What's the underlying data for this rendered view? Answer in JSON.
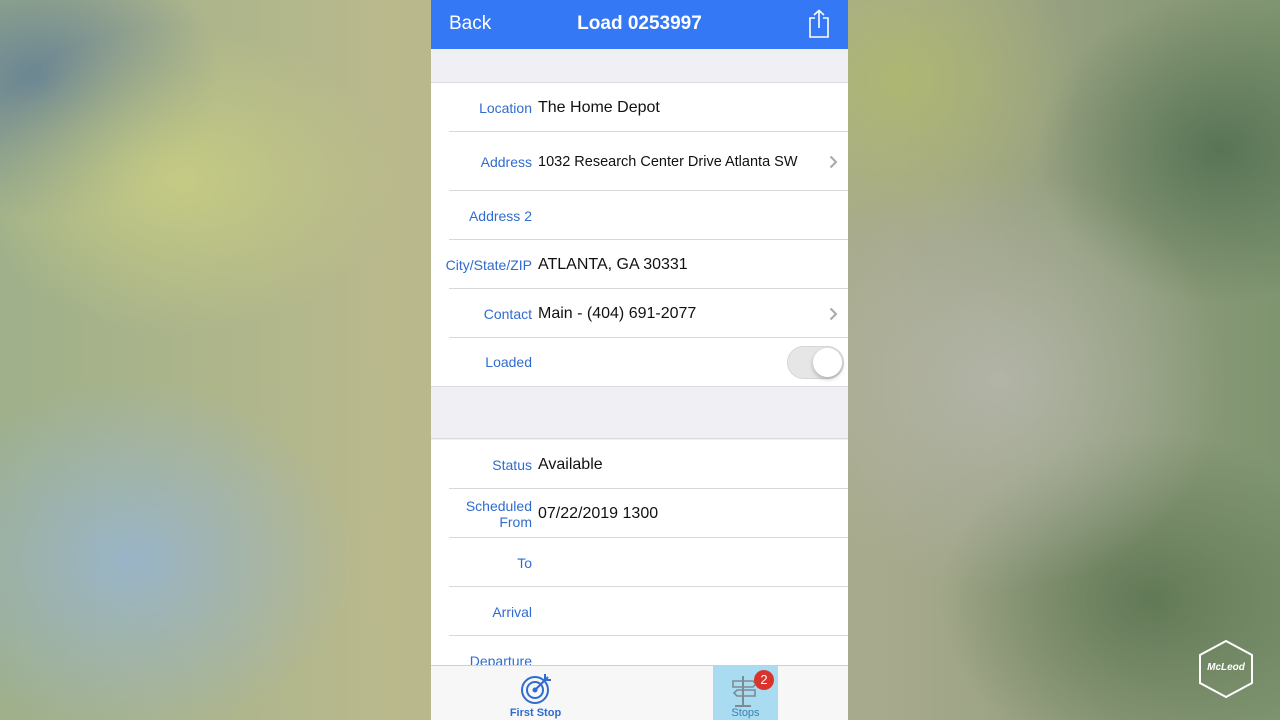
{
  "navbar": {
    "back_label": "Back",
    "title": "Load 0253997",
    "share_icon": "share-icon"
  },
  "location_section": {
    "location": {
      "label": "Location",
      "value": "The Home Depot"
    },
    "address": {
      "label": "Address",
      "value": "1032 Research Center Drive Atlanta SW"
    },
    "address2": {
      "label": "Address 2",
      "value": ""
    },
    "city_state_zip": {
      "label": "City/State/ZIP",
      "value": "ATLANTA, GA 30331"
    },
    "contact": {
      "label": "Contact",
      "value": "Main - (404) 691-2077"
    },
    "loaded": {
      "label": "Loaded",
      "on": false
    }
  },
  "status_section": {
    "status": {
      "label": "Status",
      "value": "Available"
    },
    "scheduled_from": {
      "label_line1": "Scheduled",
      "label_line2": "From",
      "value": "07/22/2019 1300"
    },
    "to": {
      "label": "To",
      "value": ""
    },
    "arrival": {
      "label": "Arrival",
      "value": ""
    },
    "departure": {
      "label": "Departure",
      "value": ""
    }
  },
  "tabbar": {
    "first_stop_label": "First Stop",
    "stops_label": "Stops",
    "stops_badge": "2"
  },
  "watermark": {
    "brand": "McLeod"
  },
  "colors": {
    "navbar": "#3478f6",
    "label_blue": "#2f6ccf",
    "badge_red": "#d9332b",
    "stops_tab_highlight": "#a9dcf0"
  }
}
